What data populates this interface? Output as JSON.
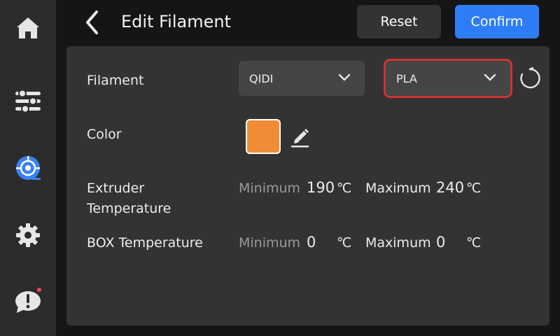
{
  "header": {
    "title": "Edit Filament",
    "reset_label": "Reset",
    "confirm_label": "Confirm"
  },
  "sidebar": {
    "items": [
      {
        "icon": "home-icon"
      },
      {
        "icon": "sliders-icon"
      },
      {
        "icon": "filament-spool-icon",
        "active": true
      },
      {
        "icon": "gear-icon"
      },
      {
        "icon": "alert-message-icon",
        "badge": true
      }
    ]
  },
  "form": {
    "filament_label": "Filament",
    "brand_value": "QIDI",
    "type_value": "PLA",
    "color_label": "Color",
    "color_value": "#f28b36",
    "extruder_label_line1": "Extruder",
    "extruder_label_line2": "Temperature",
    "box_label": "BOX Temperature",
    "minimum_label": "Minimum",
    "maximum_label": "Maximum",
    "unit": "℃",
    "extruder_min": "190",
    "extruder_max": "240",
    "box_min": "0",
    "box_max": "0"
  },
  "colors": {
    "accent": "#2f7df6",
    "highlight_outline": "#d03232",
    "active_icon": "#3b82f6"
  }
}
